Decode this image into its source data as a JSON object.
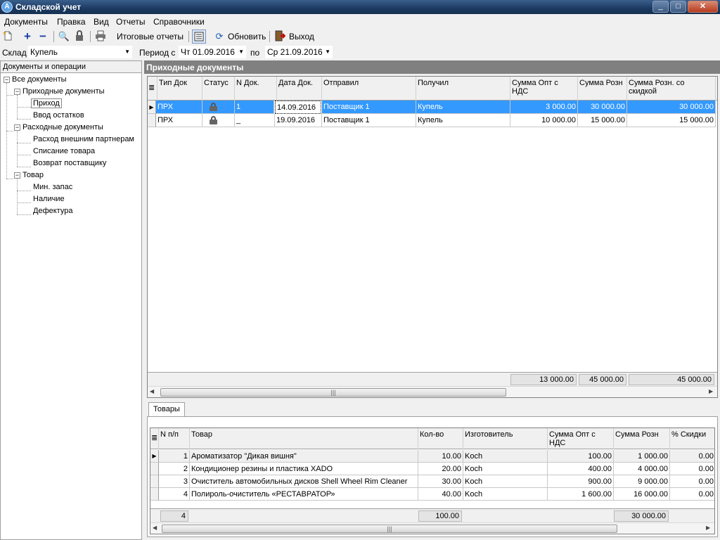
{
  "window": {
    "title": "Складской учет",
    "app_icon_letter": "A",
    "minimize_glyph": "_",
    "maximize_glyph": "□",
    "close_glyph": "✕"
  },
  "menu": [
    "Документы",
    "Правка",
    "Вид",
    "Отчеты",
    "Справочники"
  ],
  "toolbar": {
    "icons": [
      "new-document-icon",
      "plus-icon",
      "minus-icon",
      "search-icon",
      "lock-icon",
      "print-icon",
      "list-icon",
      "refresh-icon",
      "exit-icon"
    ],
    "summary_reports": "Итоговые отчеты",
    "refresh": "Обновить",
    "exit": "Выход"
  },
  "filter": {
    "warehouse_label": "Склад",
    "warehouse_value": "Купель",
    "period_label": "Период с",
    "period_from": "Чт 01.09.2016",
    "period_to_label": "по",
    "period_to": "Ср 21.09.2016"
  },
  "tree": {
    "header": "Документы и операции",
    "root": "Все документы",
    "incoming": "Приходные документы",
    "incoming_children": [
      "Приход",
      "Ввод остатков"
    ],
    "outgoing": "Расходные документы",
    "outgoing_children": [
      "Расход внешним партнерам",
      "Списание товара",
      "Возврат поставщику"
    ],
    "goods": "Товар",
    "goods_children": [
      "Мин. запас",
      "Наличие",
      "Дефектура"
    ],
    "selected": "Приход"
  },
  "incoming_docs": {
    "title": "Приходные документы",
    "columns": [
      "Тип Док",
      "Статус",
      "N Док.",
      "Дата Док.",
      "Отправил",
      "Получил",
      "Сумма Опт с НДС",
      "Сумма Розн",
      "Сумма Розн. со скидкой"
    ],
    "rows": [
      {
        "type": "ПРХ",
        "status": "locked",
        "num": "1",
        "date": "14.09.2016",
        "sender": "Поставщик 1",
        "receiver": "Купель",
        "sum_opt": "3 000.00",
        "sum_retail": "30 000.00",
        "sum_retail_disc": "30 000.00"
      },
      {
        "type": "ПРХ",
        "status": "locked",
        "num": "_",
        "date": "19.09.2016",
        "sender": "Поставщик 1",
        "receiver": "Купель",
        "sum_opt": "10 000.00",
        "sum_retail": "15 000.00",
        "sum_retail_disc": "15 000.00"
      }
    ],
    "totals": {
      "sum_opt": "13 000.00",
      "sum_retail": "45 000.00",
      "sum_retail_disc": "45 000.00"
    }
  },
  "goods_tab": {
    "tab_label": "Товары",
    "columns": [
      "N п/п",
      "Товар",
      "Кол-во",
      "Изготовитель",
      "Сумма Опт с НДС",
      "Сумма Розн",
      "% Скидки"
    ],
    "rows": [
      {
        "n": "1",
        "name": "Ароматизатор \"Дикая вишня\"",
        "qty": "10.00",
        "maker": "Koch",
        "sum_opt": "100.00",
        "sum_retail": "1 000.00",
        "discount": "0.00"
      },
      {
        "n": "2",
        "name": "Кондиционер резины и пластика XADO",
        "qty": "20.00",
        "maker": "Koch",
        "sum_opt": "400.00",
        "sum_retail": "4 000.00",
        "discount": "0.00"
      },
      {
        "n": "3",
        "name": "Очиститель автомобильных дисков Shell Wheel Rim Cleaner",
        "qty": "30.00",
        "maker": "Koch",
        "sum_opt": "900.00",
        "sum_retail": "9 000.00",
        "discount": "0.00"
      },
      {
        "n": "4",
        "name": "Полироль-очиститель «РЕСТАВРАТОР»",
        "qty": "40.00",
        "maker": "Koch",
        "sum_opt": "1 600.00",
        "sum_retail": "16 000.00",
        "discount": "0.00"
      }
    ],
    "totals": {
      "count": "4",
      "qty": "100.00",
      "sum_retail": "30 000.00"
    }
  }
}
